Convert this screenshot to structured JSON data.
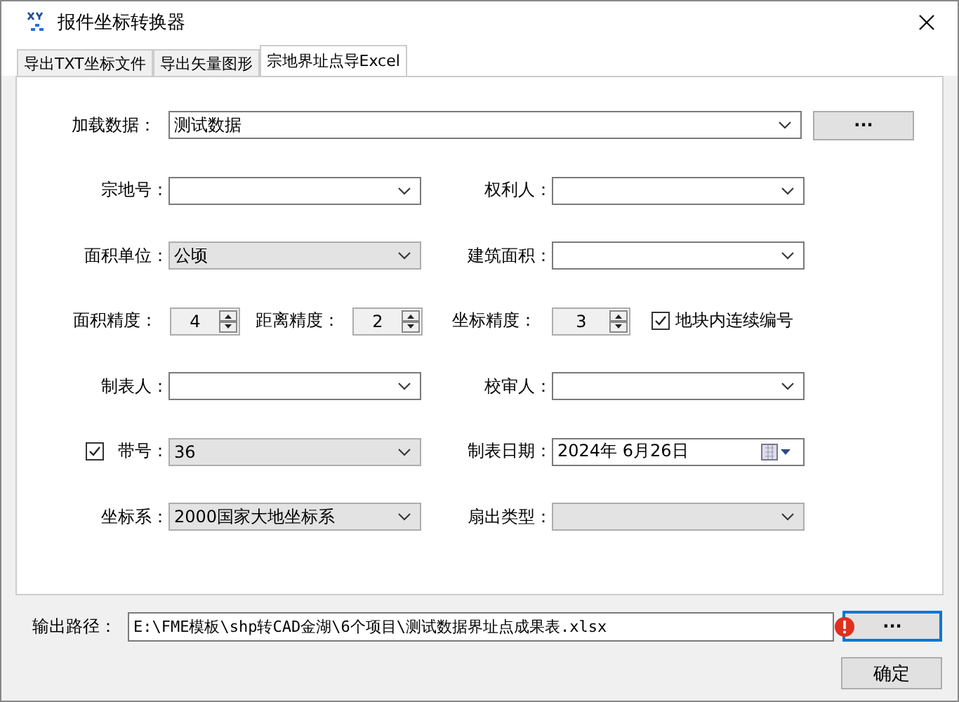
{
  "window": {
    "title": "报件坐标转换器"
  },
  "tabs": [
    {
      "label": "导出TXT坐标文件",
      "selected": false
    },
    {
      "label": "导出矢量图形",
      "selected": false
    },
    {
      "label": "宗地界址点导Excel",
      "selected": true
    }
  ],
  "load": {
    "label": "加载数据：",
    "value": "测试数据",
    "button": "···"
  },
  "rows": [
    {
      "fields": [
        {
          "kind": "combo",
          "label": "宗地号：",
          "editable": true
        },
        {
          "kind": "combo",
          "label": "权利人：",
          "editable": true
        }
      ]
    },
    {
      "fields": [
        {
          "kind": "combo",
          "label": "面积单位：",
          "value": "公顷",
          "editable": false
        },
        {
          "kind": "combo",
          "label": "建筑面积：",
          "editable": true
        }
      ]
    },
    {
      "fields": [
        {
          "kind": "spin",
          "label": "面积精度：",
          "value": "4"
        },
        {
          "kind": "spin",
          "label": "距离精度：",
          "value": "2"
        },
        {
          "kind": "spin",
          "label": "坐标精度：",
          "value": "3"
        },
        {
          "kind": "check",
          "label": "地块内连续编号",
          "checked": true
        }
      ]
    },
    {
      "fields": [
        {
          "kind": "combo",
          "label": "制表人：",
          "editable": true
        },
        {
          "kind": "combo",
          "label": "校审人：",
          "editable": true
        }
      ]
    },
    {
      "fields": [
        {
          "kind": "combo",
          "label": "带号：",
          "value": "36",
          "editable": false,
          "checked": true
        },
        {
          "kind": "date",
          "label": "制表日期：",
          "value": "2024年  6月26日"
        }
      ]
    },
    {
      "fields": [
        {
          "kind": "combo",
          "label": "坐标系：",
          "value": "2000国家大地坐标系",
          "editable": false
        },
        {
          "kind": "combo",
          "label": "扇出类型：",
          "editable": false
        }
      ]
    }
  ],
  "output": {
    "label": "输出路径：",
    "value": "E:\\FME模板\\shp转CAD金湖\\6个项目\\测试数据界址点成果表.xlsx",
    "error": true,
    "button": "···"
  },
  "confirm": "确定"
}
